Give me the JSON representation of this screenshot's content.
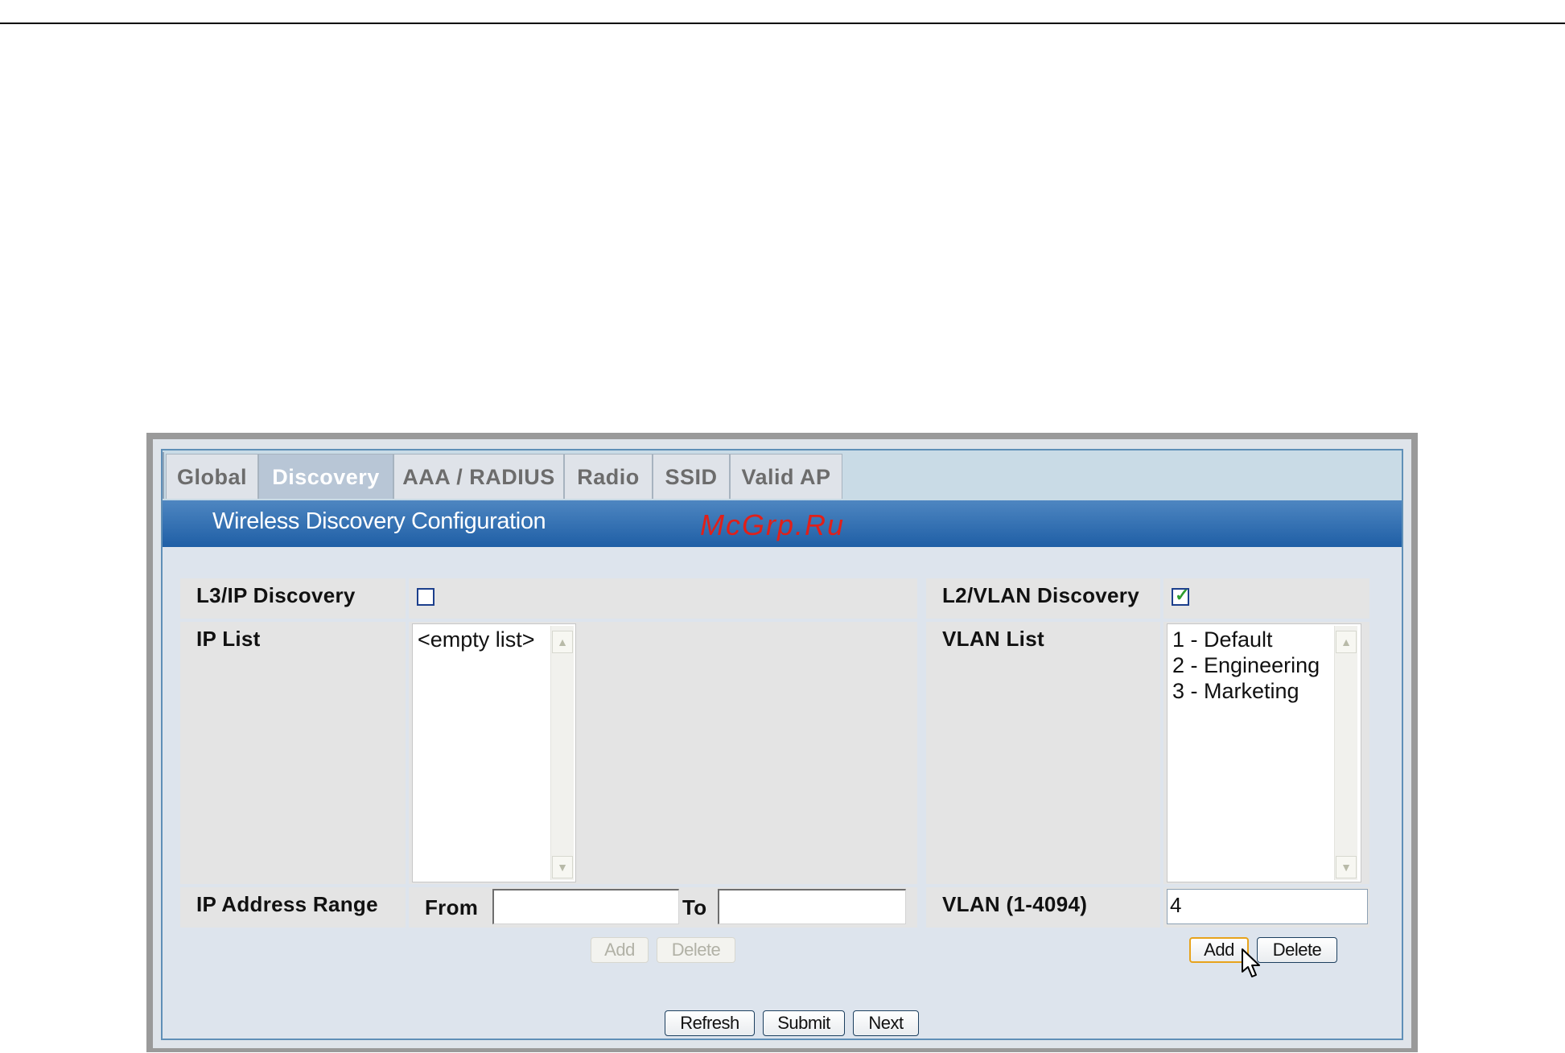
{
  "tabs": [
    {
      "label": "Global",
      "active": false
    },
    {
      "label": "Discovery",
      "active": true
    },
    {
      "label": "AAA / RADIUS",
      "active": false
    },
    {
      "label": "Radio",
      "active": false
    },
    {
      "label": "SSID",
      "active": false
    },
    {
      "label": "Valid AP",
      "active": false
    }
  ],
  "header": {
    "title": "Wireless Discovery Configuration",
    "watermark": "McGrp.Ru"
  },
  "l3": {
    "discovery_label": "L3/IP Discovery",
    "discovery_checked": false,
    "ip_list_label": "IP List",
    "ip_list_items": [
      "<empty list>"
    ],
    "range_label": "IP Address Range",
    "from_label": "From",
    "to_label": "To",
    "from_value": "",
    "to_value": "",
    "add_label": "Add",
    "delete_label": "Delete"
  },
  "l2": {
    "discovery_label": "L2/VLAN Discovery",
    "discovery_checked": true,
    "vlan_list_label": "VLAN List",
    "vlan_list_items": [
      "1 - Default",
      "2 - Engineering",
      "3 - Marketing"
    ],
    "vlan_input_label": "VLAN (1-4094)",
    "vlan_input_value": "4",
    "add_label": "Add",
    "delete_label": "Delete"
  },
  "footer": {
    "refresh_label": "Refresh",
    "submit_label": "Submit",
    "next_label": "Next"
  },
  "colors": {
    "header_bar": "#1f5fa6",
    "tab_active": "#b8c6d6",
    "checkmark": "#2e9d2e",
    "watermark": "#e0201a"
  }
}
